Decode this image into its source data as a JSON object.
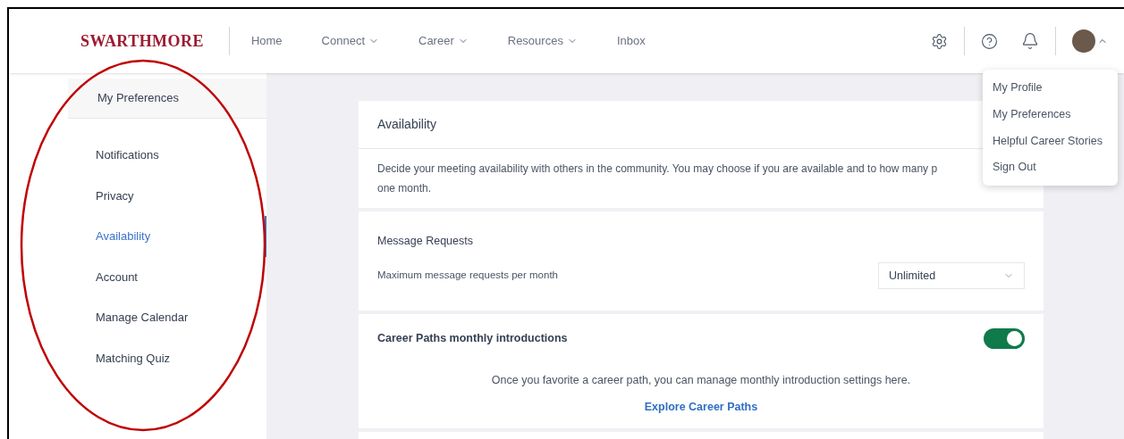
{
  "header": {
    "logo": "SWARTHMORE",
    "nav": [
      {
        "label": "Home",
        "dropdown": false
      },
      {
        "label": "Connect",
        "dropdown": true
      },
      {
        "label": "Career",
        "dropdown": true
      },
      {
        "label": "Resources",
        "dropdown": true
      },
      {
        "label": "Inbox",
        "dropdown": false
      }
    ],
    "user_menu": {
      "expanded": true,
      "items": [
        "My Profile",
        "My Preferences",
        "Helpful Career Stories",
        "Sign Out"
      ]
    }
  },
  "sidebar": {
    "title": "My Preferences",
    "items": [
      {
        "label": "Notifications",
        "selected": false
      },
      {
        "label": "Privacy",
        "selected": false
      },
      {
        "label": "Availability",
        "selected": true
      },
      {
        "label": "Account",
        "selected": false
      },
      {
        "label": "Manage Calendar",
        "selected": false
      },
      {
        "label": "Matching Quiz",
        "selected": false
      }
    ]
  },
  "card": {
    "title": "Availability",
    "description": [
      "Decide your meeting availability with others in the community. You may choose if you are available and to how many p",
      "one month."
    ],
    "message_requests": {
      "title": "Message Requests",
      "label": "Maximum message requests per month",
      "value": "Unlimited"
    },
    "career_paths": {
      "title": "Career Paths monthly introductions",
      "on": true,
      "note": "Once you favorite a career path, you can manage monthly introduction settings here.",
      "link": "Explore Career Paths"
    }
  }
}
